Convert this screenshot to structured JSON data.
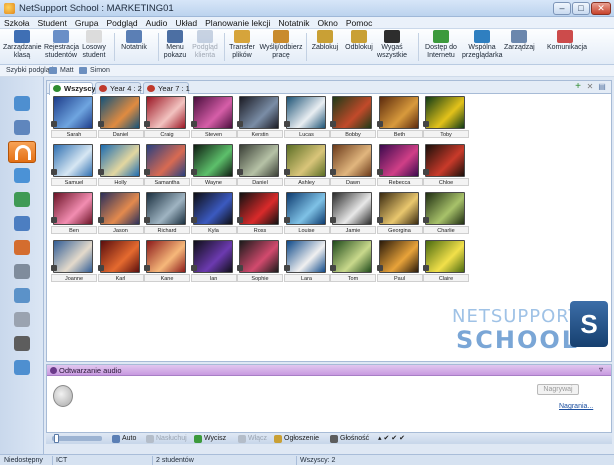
{
  "window": {
    "title": "NetSupport School : MARKETING01",
    "controls": [
      "–",
      "□",
      "✕"
    ]
  },
  "menu": [
    "Szkoła",
    "Student",
    "Grupa",
    "Podgląd",
    "Audio",
    "Układ",
    "Planowanie lekcji",
    "Notatnik",
    "Okno",
    "Pomoc"
  ],
  "toolbar": [
    {
      "label1": "Zarządzanie",
      "label2": "klasą",
      "icon": "class-icon",
      "color": "#3f6fb4",
      "enabled": true
    },
    {
      "label1": "Rejestracja",
      "label2": "studentów",
      "icon": "register-icon",
      "color": "#6a8fc7",
      "enabled": true
    },
    {
      "label1": "Losowy",
      "label2": "student",
      "icon": "dice-icon",
      "color": "#dcdcdc",
      "enabled": true
    },
    {
      "label1": "Notatnik",
      "label2": "",
      "icon": "notebook-icon",
      "color": "#5b7fb5",
      "enabled": true
    },
    {
      "label1": "Menu",
      "label2": "pokazu",
      "icon": "show-icon",
      "color": "#4c6fa3",
      "enabled": true
    },
    {
      "label1": "Podgląd",
      "label2": "klienta",
      "icon": "view-client-icon",
      "color": "#8aa0c2",
      "enabled": false
    },
    {
      "label1": "Transfer",
      "label2": "plików",
      "icon": "transfer-icon",
      "color": "#d6a43b",
      "enabled": true
    },
    {
      "label1": "Wyślij/odbierz",
      "label2": "pracę",
      "icon": "send-collect-icon",
      "color": "#c98b2d",
      "enabled": true
    },
    {
      "label1": "Zablokuj",
      "label2": "",
      "icon": "lock-icon",
      "color": "#c9a035",
      "enabled": true
    },
    {
      "label1": "Odblokuj",
      "label2": "",
      "icon": "unlock-icon",
      "color": "#c9a035",
      "enabled": true
    },
    {
      "label1": "Wygaś",
      "label2": "wszystkie",
      "icon": "blank-screen-icon",
      "color": "#2d2d2d",
      "enabled": true
    },
    {
      "label1": "Dostęp do",
      "label2": "Internetu",
      "icon": "internet-icon",
      "color": "#3c9a3c",
      "enabled": true
    },
    {
      "label1": "Wspólna",
      "label2": "przeglądarka",
      "icon": "browser-icon",
      "color": "#2f7fc0",
      "enabled": true
    },
    {
      "label1": "Zarządzaj",
      "label2": "",
      "icon": "manage-icon",
      "color": "#6b87ad",
      "enabled": true
    },
    {
      "label1": "Komunikacja",
      "label2": "",
      "icon": "chat-icon",
      "color": "#cc4b4b",
      "enabled": true
    }
  ],
  "quickbar": {
    "label": "Szybki podgląd:",
    "items": [
      "Matt",
      "Simon"
    ]
  },
  "sidebar": [
    {
      "icon": "home-icon",
      "color": "#4e8fd0",
      "active": false
    },
    {
      "icon": "thumbnail-icon",
      "color": "#5f86bd",
      "active": false
    },
    {
      "icon": "headphones-icon",
      "color": "#ffffff",
      "active": true
    },
    {
      "icon": "question-icon",
      "color": "#4b92d6",
      "active": false
    },
    {
      "icon": "globe-icon",
      "color": "#3f9a55",
      "active": false
    },
    {
      "icon": "window-icon",
      "color": "#4c7ec1",
      "active": false
    },
    {
      "icon": "pie-icon",
      "color": "#d46d2f",
      "active": false
    },
    {
      "icon": "printer-icon",
      "color": "#7f8c9c",
      "active": false
    },
    {
      "icon": "user-icon",
      "color": "#5b92c9",
      "active": false
    },
    {
      "icon": "disc-icon",
      "color": "#9aa3b0",
      "active": false
    },
    {
      "icon": "keyboard-icon",
      "color": "#5d5d5d",
      "active": false
    },
    {
      "icon": "chart-icon",
      "color": "#4e8fd0",
      "active": false
    }
  ],
  "tabs": [
    {
      "label": "Wszyscy: 2",
      "active": true,
      "color": "#2f8c2f"
    },
    {
      "label": "Year 4 : 2",
      "active": false,
      "color": "#c0392b"
    },
    {
      "label": "Year 7 : 1",
      "active": false,
      "color": "#c0392b"
    }
  ],
  "tab_actions": [
    "+",
    "✕",
    "▤"
  ],
  "students": [
    {
      "name": "Sarah",
      "c1": "#1d3c8a",
      "c2": "#6fa5e0"
    },
    {
      "name": "Daniel",
      "c1": "#14537a",
      "c2": "#e08b40"
    },
    {
      "name": "Craig",
      "c1": "#9b1624",
      "c2": "#f2c3c0"
    },
    {
      "name": "Steven",
      "c1": "#4a0f3d",
      "c2": "#d65ea8"
    },
    {
      "name": "Kerstin",
      "c1": "#1b1b24",
      "c2": "#7a8da6"
    },
    {
      "name": "Lucas",
      "c1": "#1e5476",
      "c2": "#e9eef2"
    },
    {
      "name": "Bobby",
      "c1": "#1f3a17",
      "c2": "#c24a2a"
    },
    {
      "name": "Beth",
      "c1": "#5c2a0d",
      "c2": "#d89a3c"
    },
    {
      "name": "Toby",
      "c1": "#0f3a16",
      "c2": "#e3c21a"
    },
    {
      "name": "Samuel",
      "c1": "#2f6fb1",
      "c2": "#d7e7f3"
    },
    {
      "name": "Holly",
      "c1": "#1b6bb0",
      "c2": "#e3d7a0"
    },
    {
      "name": "Samantha",
      "c1": "#28407f",
      "c2": "#d86a52"
    },
    {
      "name": "Wayne",
      "c1": "#0f1d12",
      "c2": "#5dc06b"
    },
    {
      "name": "Daniel",
      "c1": "#3a3f36",
      "c2": "#b6c2a6"
    },
    {
      "name": "Ashley",
      "c1": "#5b6e25",
      "c2": "#d9c57a"
    },
    {
      "name": "Dawn",
      "c1": "#6b3a1a",
      "c2": "#e1b67e"
    },
    {
      "name": "Rebecca",
      "c1": "#3b0a4e",
      "c2": "#d03f87"
    },
    {
      "name": "Chloe",
      "c1": "#1a0f0a",
      "c2": "#c93a2a"
    },
    {
      "name": "Ben",
      "c1": "#6b1326",
      "c2": "#f28db1"
    },
    {
      "name": "Jason",
      "c1": "#2b2f5a",
      "c2": "#e38a4e"
    },
    {
      "name": "Richard",
      "c1": "#1a2f3f",
      "c2": "#9fb4c2"
    },
    {
      "name": "Kyla",
      "c1": "#0e0e14",
      "c2": "#3b5ac0"
    },
    {
      "name": "Ross",
      "c1": "#111",
      "c2": "#d92a2a"
    },
    {
      "name": "Louise",
      "c1": "#0d3a6e",
      "c2": "#7fc2e6"
    },
    {
      "name": "Jamie",
      "c1": "#2b2b2b",
      "c2": "#e8e8e8"
    },
    {
      "name": "Georgina",
      "c1": "#3a2a10",
      "c2": "#e9c76e"
    },
    {
      "name": "Charlie",
      "c1": "#1f2e12",
      "c2": "#a8c26a"
    },
    {
      "name": "Joanne",
      "c1": "#315d96",
      "c2": "#e4dacb"
    },
    {
      "name": "Karl",
      "c1": "#5a0e0e",
      "c2": "#e56a2f"
    },
    {
      "name": "Kane",
      "c1": "#8b1a1a",
      "c2": "#f6b87a"
    },
    {
      "name": "Ian",
      "c1": "#0f0f18",
      "c2": "#6c3ab0"
    },
    {
      "name": "Sophie",
      "c1": "#1b1b1b",
      "c2": "#d24a6e"
    },
    {
      "name": "Lara",
      "c1": "#0f4a8a",
      "c2": "#f0f0f0"
    },
    {
      "name": "Tom",
      "c1": "#1f4a1a",
      "c2": "#c9d98c"
    },
    {
      "name": "Paul",
      "c1": "#2a1a0a",
      "c2": "#e8a33a"
    },
    {
      "name": "Claire",
      "c1": "#4a6a10",
      "c2": "#f2e04a"
    }
  ],
  "logo": {
    "line1": "NETSUPPORT",
    "line2": "SCHOOL",
    "badge": "S"
  },
  "audio": {
    "title": "Odtwarzanie audio",
    "listen": "Nagrywaj",
    "recordings": "Nagrania..."
  },
  "controls": [
    {
      "label": "Auto",
      "enabled": true
    },
    {
      "label": "Nasłuchuj",
      "enabled": false
    },
    {
      "label": "Wycisz",
      "enabled": true
    },
    {
      "label": "Włącz",
      "enabled": false
    },
    {
      "label": "Ogłoszenie",
      "enabled": true
    },
    {
      "label": "Głośność",
      "enabled": true
    }
  ],
  "status": {
    "s1": "Niedostępny",
    "s2": "ICT",
    "s3": "2 studentów",
    "s4": "Wszyscy: 2"
  }
}
